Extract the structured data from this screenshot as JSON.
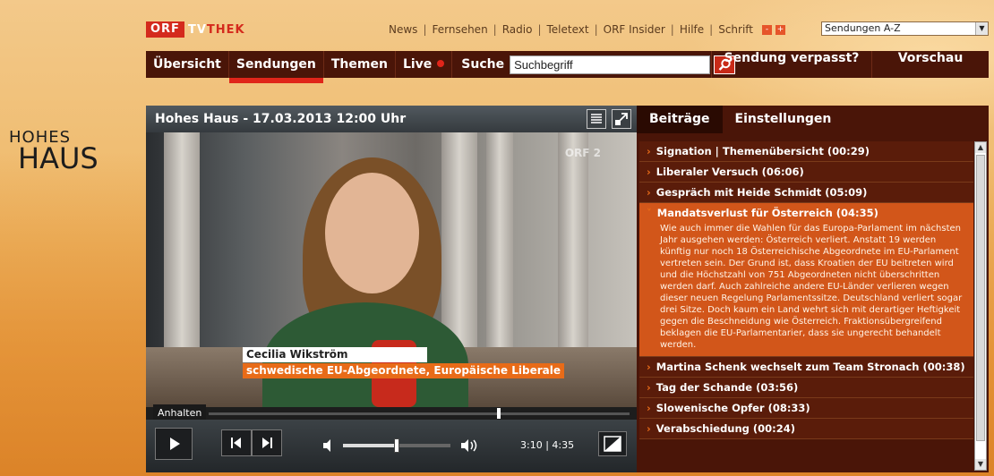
{
  "logo": {
    "orf": "ORF",
    "tv": "TV",
    "thek": "THEK"
  },
  "top_links": [
    "News",
    "Fernsehen",
    "Radio",
    "Teletext",
    "ORF Insider",
    "Hilfe"
  ],
  "font_size": {
    "label": "Schrift",
    "minus": "-",
    "plus": "+"
  },
  "dropdown": {
    "selected": "Sendungen A-Z"
  },
  "nav": {
    "items": [
      "Übersicht",
      "Sendungen",
      "Themen",
      "Live"
    ],
    "search_label": "Suche",
    "search_placeholder": "Suchbegriff",
    "missed": "Sendung verpasst?",
    "preview": "Vorschau"
  },
  "brand": {
    "line1": "HOHES",
    "line2": "HAUS"
  },
  "player": {
    "title": "Hohes Haus - 17.03.2013 12:00 Uhr",
    "channel_logo": "ORF 2",
    "lower_third_name": "Cecilia Wikström",
    "lower_third_role": "schwedische EU-Abgeordnete, Europäische Liberale",
    "tooltip": "Anhalten",
    "timecode": "3:10 | 4:35",
    "progress": 0.69,
    "volume": 0.5
  },
  "side": {
    "tabs": [
      "Beiträge",
      "Einstellungen"
    ],
    "items": [
      {
        "title": "Signation | Themenübersicht (00:29)"
      },
      {
        "title": "Liberaler Versuch (06:06)"
      },
      {
        "title": "Gespräch mit Heide Schmidt (05:09)"
      },
      {
        "title": "Mandatsverlust für Österreich (04:35)",
        "description": "Wie auch immer die Wahlen für das Europa-Parlament im nächsten Jahr ausgehen werden: Österreich verliert. Anstatt 19 werden künftig nur noch 18 Österreichische Abgeordnete im EU-Parlament vertreten sein. Der Grund ist, dass Kroatien der EU beitreten wird und die Höchstzahl von 751 Abgeordneten nicht überschritten werden darf. Auch zahlreiche andere EU-Länder verlieren wegen dieser neuen Regelung Parlamentssitze. Deutschland verliert sogar drei Sitze. Doch kaum ein Land wehrt sich mit derartiger Heftigkeit gegen die Beschneidung wie Österreich. Fraktionsübergreifend beklagen die EU-Parlamentarier, dass sie ungerecht behandelt werden."
      },
      {
        "title": "Martina Schenk wechselt zum Team Stronach (00:38)"
      },
      {
        "title": "Tag der Schande (03:56)"
      },
      {
        "title": "Slowenische Opfer (08:33)"
      },
      {
        "title": "Verabschiedung (00:24)"
      }
    ]
  },
  "colors": {
    "nav_bg": "#4a1508",
    "accent_red": "#e0251a",
    "active_item": "#d2561a",
    "orange": "#e86b18"
  }
}
